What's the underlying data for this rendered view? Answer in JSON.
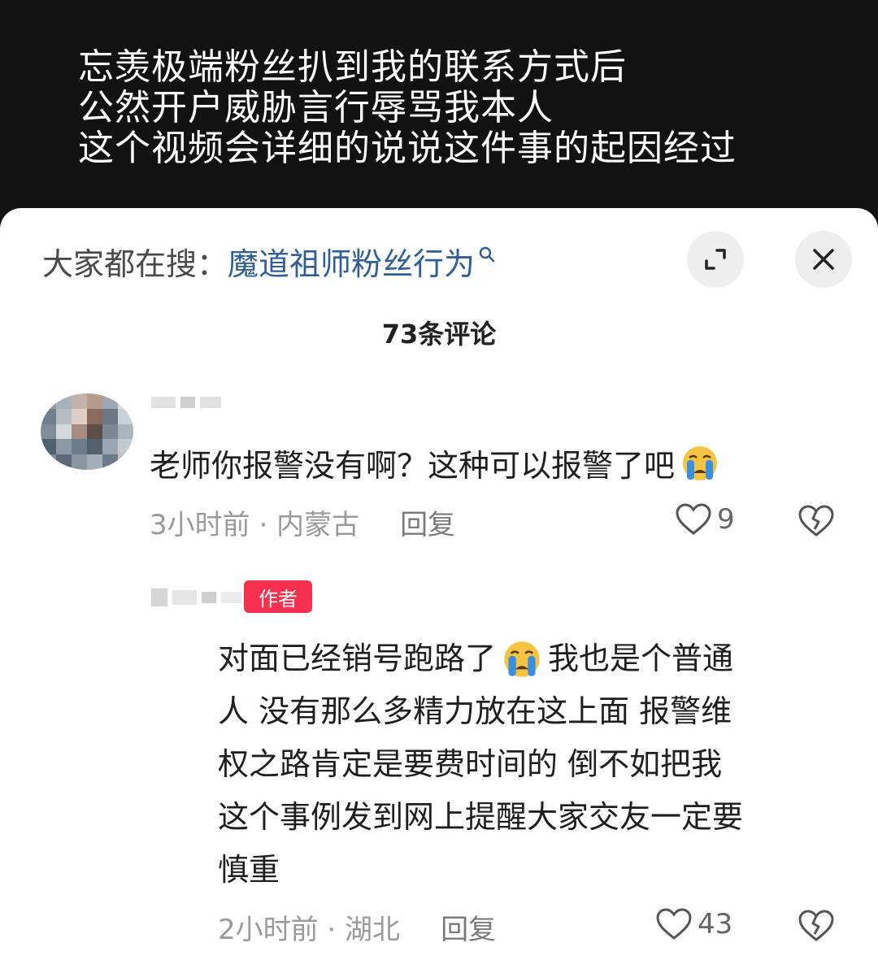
{
  "video_caption": {
    "lines": [
      "忘羡极端粉丝扒到我的联系方式后",
      "公然开户威胁言行辱骂我本人",
      "这个视频会详细的说说这件事的起因经过"
    ]
  },
  "comments_sheet": {
    "search_prefix": "大家都在搜：",
    "search_term": "魔道祖师粉丝行为",
    "comment_count": "73条评论",
    "comment": {
      "text": "老师你报警没有啊？这种可以报警了吧",
      "time_location": "3小时前 · 内蒙古",
      "reply_label": "回复",
      "likes": "9",
      "emoji": "crying-face-emoji"
    },
    "reply": {
      "author_badge": "作者",
      "lines": [
        {
          "before": "对面已经销号跑路了",
          "emoji": "crying-face-emoji",
          "after": "我也是个普通"
        },
        "人 没有那么多精力放在这上面 报警维",
        "权之路肯定是要费时间的 倒不如把我",
        "这个事例发到网上提醒大家交友一定要",
        "慎重"
      ],
      "time_location": "2小时前 · 湖北",
      "reply_label": "回复",
      "likes": "43"
    }
  },
  "colors": {
    "link": "#2f5f96",
    "author_badge": "#f5314f",
    "emoji_yellow": "#f6c443",
    "emoji_tears": "#3a8fe0"
  }
}
